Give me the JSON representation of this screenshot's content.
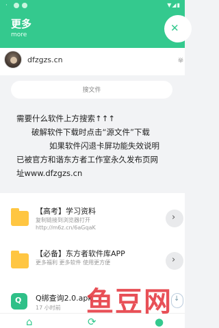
{
  "status_bar": {
    "time": "·",
    "icons": "▼◢▮"
  },
  "header": {
    "title": "更多",
    "subtitle": "more",
    "close_glyph": "✕"
  },
  "profile": {
    "site_name": "dfzgzs.cn",
    "tag": "举"
  },
  "search": {
    "label": "搜文件"
  },
  "notice": {
    "lines": [
      "需要什么软件上方搜索↑↑↑",
      "破解软件下载时点击“源文件”下载",
      "如果软件闪退卡屏功能失效说明",
      "已被官方和谐东方者工作室永久发布页网",
      "址www.dfzgzs.cn"
    ]
  },
  "list": {
    "items": [
      {
        "title": "【高考】学习资料",
        "subtitle": "复制链接到浏览器打开",
        "link": "http://m6z.cn/6aGqaK",
        "chevron": "›"
      },
      {
        "title": "【必备】东方者软件库APP",
        "subtitle": "更多福利 更多软件 使用更方便",
        "link": "",
        "chevron": "›"
      }
    ],
    "apk": {
      "icon_text": "Q",
      "title": "Q绑查询2.0.apk",
      "meta": "17 小时前",
      "download_glyph": "↓"
    }
  },
  "tabs": [
    {
      "name": "home",
      "glyph": "⌂"
    },
    {
      "name": "refresh",
      "glyph": "⟳"
    },
    {
      "name": "profile",
      "glyph": "●"
    }
  ],
  "watermark": "鱼豆网",
  "colors": {
    "accent": "#34c98e",
    "folder": "#ffc642",
    "watermark": "#e5323a"
  }
}
